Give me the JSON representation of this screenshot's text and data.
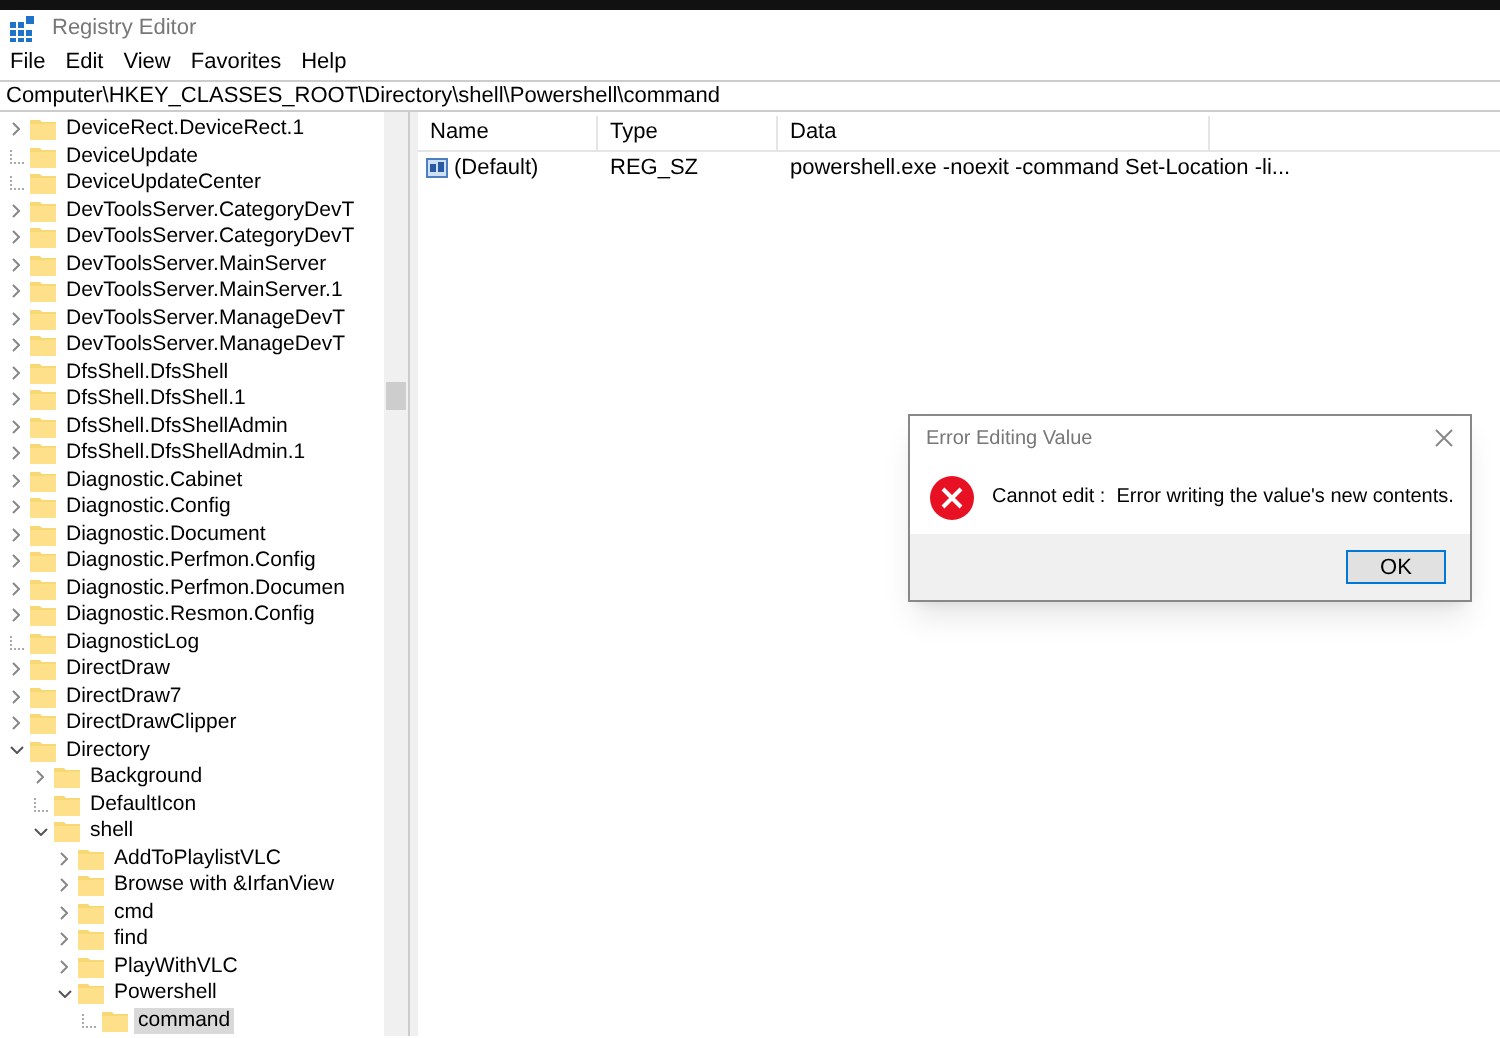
{
  "window": {
    "title": "Registry Editor"
  },
  "menu": [
    "File",
    "Edit",
    "View",
    "Favorites",
    "Help"
  ],
  "address": "Computer\\HKEY_CLASSES_ROOT\\Directory\\shell\\Powershell\\command",
  "tree": [
    {
      "label": "DeviceRect.DeviceRect.1",
      "expandable": true,
      "expanded": false,
      "selected": false
    },
    {
      "label": "DeviceUpdate",
      "expandable": false,
      "selected": false
    },
    {
      "label": "DeviceUpdateCenter",
      "expandable": false,
      "selected": false
    },
    {
      "label": "DevToolsServer.CategoryDevT",
      "expandable": true,
      "expanded": false,
      "selected": false
    },
    {
      "label": "DevToolsServer.CategoryDevT",
      "expandable": true,
      "expanded": false,
      "selected": false
    },
    {
      "label": "DevToolsServer.MainServer",
      "expandable": true,
      "expanded": false,
      "selected": false
    },
    {
      "label": "DevToolsServer.MainServer.1",
      "expandable": true,
      "expanded": false,
      "selected": false
    },
    {
      "label": "DevToolsServer.ManageDevT",
      "expandable": true,
      "expanded": false,
      "selected": false
    },
    {
      "label": "DevToolsServer.ManageDevT",
      "expandable": true,
      "expanded": false,
      "selected": false
    },
    {
      "label": "DfsShell.DfsShell",
      "expandable": true,
      "expanded": false,
      "selected": false
    },
    {
      "label": "DfsShell.DfsShell.1",
      "expandable": true,
      "expanded": false,
      "selected": false
    },
    {
      "label": "DfsShell.DfsShellAdmin",
      "expandable": true,
      "expanded": false,
      "selected": false
    },
    {
      "label": "DfsShell.DfsShellAdmin.1",
      "expandable": true,
      "expanded": false,
      "selected": false
    },
    {
      "label": "Diagnostic.Cabinet",
      "expandable": true,
      "expanded": false,
      "selected": false
    },
    {
      "label": "Diagnostic.Config",
      "expandable": true,
      "expanded": false,
      "selected": false
    },
    {
      "label": "Diagnostic.Document",
      "expandable": true,
      "expanded": false,
      "selected": false
    },
    {
      "label": "Diagnostic.Perfmon.Config",
      "expandable": true,
      "expanded": false,
      "selected": false
    },
    {
      "label": "Diagnostic.Perfmon.Documen",
      "expandable": true,
      "expanded": false,
      "selected": false
    },
    {
      "label": "Diagnostic.Resmon.Config",
      "expandable": true,
      "expanded": false,
      "selected": false
    },
    {
      "label": "DiagnosticLog",
      "expandable": false,
      "selected": false
    },
    {
      "label": "DirectDraw",
      "expandable": true,
      "expanded": false,
      "selected": false
    },
    {
      "label": "DirectDraw7",
      "expandable": true,
      "expanded": false,
      "selected": false
    },
    {
      "label": "DirectDrawClipper",
      "expandable": true,
      "expanded": false,
      "selected": false
    },
    {
      "label": "Directory",
      "expandable": true,
      "expanded": true,
      "selected": false,
      "children": [
        {
          "label": "Background",
          "expandable": true,
          "expanded": false,
          "selected": false
        },
        {
          "label": "DefaultIcon",
          "expandable": false,
          "selected": false
        },
        {
          "label": "shell",
          "expandable": true,
          "expanded": true,
          "selected": false,
          "children": [
            {
              "label": "AddToPlaylistVLC",
              "expandable": true,
              "expanded": false,
              "selected": false
            },
            {
              "label": "Browse with &IrfanView",
              "expandable": true,
              "expanded": false,
              "selected": false
            },
            {
              "label": "cmd",
              "expandable": true,
              "expanded": false,
              "selected": false
            },
            {
              "label": "find",
              "expandable": true,
              "expanded": false,
              "selected": false
            },
            {
              "label": "PlayWithVLC",
              "expandable": true,
              "expanded": false,
              "selected": false
            },
            {
              "label": "Powershell",
              "expandable": true,
              "expanded": true,
              "selected": false,
              "children": [
                {
                  "label": "command",
                  "expandable": false,
                  "selected": true
                }
              ]
            }
          ]
        }
      ]
    }
  ],
  "values": {
    "columns": [
      "Name",
      "Type",
      "Data"
    ],
    "rows": [
      {
        "name": "(Default)",
        "type": "REG_SZ",
        "data": "powershell.exe -noexit -command Set-Location -li..."
      }
    ]
  },
  "dialog": {
    "title": "Error Editing Value",
    "message": "Cannot edit :  Error writing the value's new contents.",
    "button": "OK"
  }
}
